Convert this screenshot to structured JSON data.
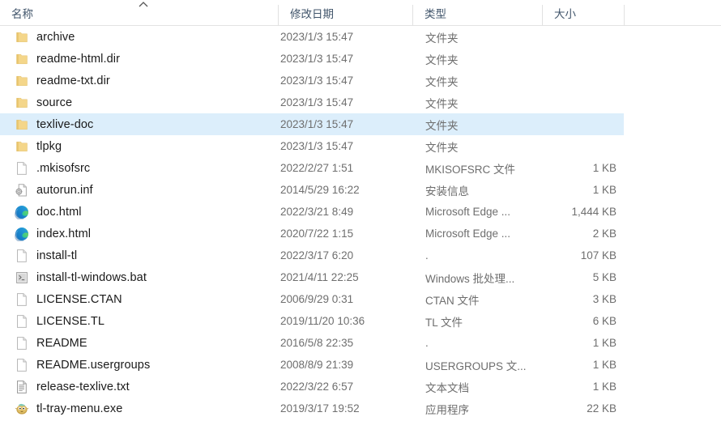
{
  "window": {
    "title": "File Explorer list view",
    "accent_selection": "#dceefb",
    "header_text_color": "#41556b",
    "folder_icon_color": "#f6d98a"
  },
  "header": {
    "sort_indicator": "chevron-up-icon",
    "sort_column": "名称",
    "sort_direction": "ascending",
    "columns": [
      {
        "key": "name",
        "label": "名称"
      },
      {
        "key": "date",
        "label": "修改日期"
      },
      {
        "key": "type",
        "label": "类型"
      },
      {
        "key": "size",
        "label": "大小"
      }
    ]
  },
  "rows": [
    {
      "name": "archive",
      "date": "2023/1/3 15:47",
      "type": "文件夹",
      "size": "",
      "icon": "folder-icon",
      "selected": false
    },
    {
      "name": "readme-html.dir",
      "date": "2023/1/3 15:47",
      "type": "文件夹",
      "size": "",
      "icon": "folder-icon",
      "selected": false
    },
    {
      "name": "readme-txt.dir",
      "date": "2023/1/3 15:47",
      "type": "文件夹",
      "size": "",
      "icon": "folder-icon",
      "selected": false
    },
    {
      "name": "source",
      "date": "2023/1/3 15:47",
      "type": "文件夹",
      "size": "",
      "icon": "folder-icon",
      "selected": false
    },
    {
      "name": "texlive-doc",
      "date": "2023/1/3 15:47",
      "type": "文件夹",
      "size": "",
      "icon": "folder-icon",
      "selected": true
    },
    {
      "name": "tlpkg",
      "date": "2023/1/3 15:47",
      "type": "文件夹",
      "size": "",
      "icon": "folder-icon",
      "selected": false
    },
    {
      "name": ".mkisofsrc",
      "date": "2022/2/27 1:51",
      "type": "MKISOFSRC 文件",
      "size": "1 KB",
      "icon": "blank-document-icon",
      "selected": false
    },
    {
      "name": "autorun.inf",
      "date": "2014/5/29 16:22",
      "type": "安装信息",
      "size": "1 KB",
      "icon": "setup-info-icon",
      "selected": false
    },
    {
      "name": "doc.html",
      "date": "2022/3/21 8:49",
      "type": "Microsoft Edge ...",
      "size": "1,444 KB",
      "icon": "edge-browser-icon",
      "selected": false
    },
    {
      "name": "index.html",
      "date": "2020/7/22 1:15",
      "type": "Microsoft Edge ...",
      "size": "2 KB",
      "icon": "edge-browser-icon",
      "selected": false
    },
    {
      "name": "install-tl",
      "date": "2022/3/17 6:20",
      "type": ".",
      "size": "107 KB",
      "icon": "blank-document-icon",
      "selected": false
    },
    {
      "name": "install-tl-windows.bat",
      "date": "2021/4/11 22:25",
      "type": "Windows 批处理...",
      "size": "5 KB",
      "icon": "batch-file-icon",
      "selected": false
    },
    {
      "name": "LICENSE.CTAN",
      "date": "2006/9/29 0:31",
      "type": "CTAN 文件",
      "size": "3 KB",
      "icon": "blank-document-icon",
      "selected": false
    },
    {
      "name": "LICENSE.TL",
      "date": "2019/11/20 10:36",
      "type": "TL 文件",
      "size": "6 KB",
      "icon": "blank-document-icon",
      "selected": false
    },
    {
      "name": "README",
      "date": "2016/5/8 22:35",
      "type": ".",
      "size": "1 KB",
      "icon": "blank-document-icon",
      "selected": false
    },
    {
      "name": "README.usergroups",
      "date": "2008/8/9 21:39",
      "type": "USERGROUPS 文...",
      "size": "1 KB",
      "icon": "blank-document-icon",
      "selected": false
    },
    {
      "name": "release-texlive.txt",
      "date": "2022/3/22 6:57",
      "type": "文本文档",
      "size": "1 KB",
      "icon": "text-document-icon",
      "selected": false
    },
    {
      "name": "tl-tray-menu.exe",
      "date": "2019/3/17 19:52",
      "type": "应用程序",
      "size": "22 KB",
      "icon": "pufferfish-app-icon",
      "selected": false
    }
  ]
}
